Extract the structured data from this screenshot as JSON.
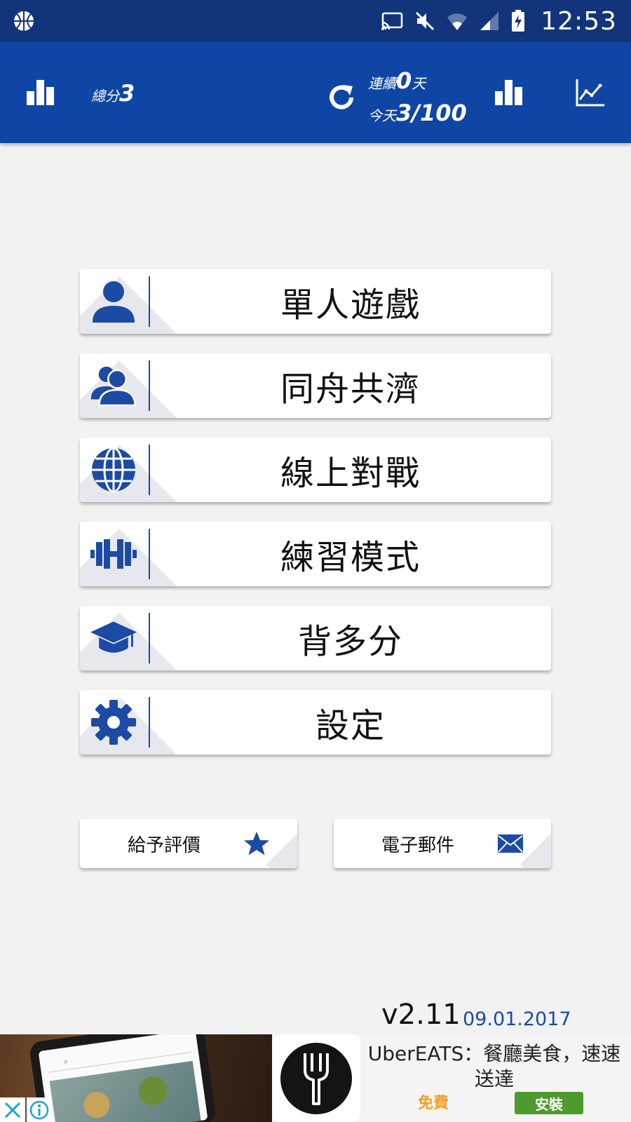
{
  "status_bar": {
    "time": "12:53",
    "icons": [
      "basketball-icon",
      "cast-icon",
      "mute-icon",
      "wifi-icon",
      "signal-icon",
      "battery-charging-icon"
    ]
  },
  "app_bar": {
    "total_label": "總分",
    "total_value": "3",
    "streak_label": "連續",
    "streak_value": "0",
    "streak_unit": "天",
    "today_label": "今天",
    "today_value": "3/100",
    "background_color": "#0f46a6"
  },
  "menu": [
    {
      "label": "單人遊戲",
      "icon": "person-icon"
    },
    {
      "label": "同舟共濟",
      "icon": "people-icon"
    },
    {
      "label": "線上對戰",
      "icon": "globe-icon"
    },
    {
      "label": "練習模式",
      "icon": "dumbbell-icon"
    },
    {
      "label": "背多分",
      "icon": "graduation-cap-icon"
    },
    {
      "label": "設定",
      "icon": "gear-icon"
    }
  ],
  "actions": {
    "rate_label": "給予評價",
    "email_label": "電子郵件"
  },
  "version": {
    "number": "v2.11",
    "date": "09.01.2017"
  },
  "ad": {
    "title": "UberEATS：餐廳美食，速速送達",
    "price": "免費",
    "install": "安裝"
  },
  "colors": {
    "accent": "#1d4aa3",
    "status_bar": "#12347a",
    "install_green": "#4d9a2e",
    "free_orange": "#f5a020"
  }
}
